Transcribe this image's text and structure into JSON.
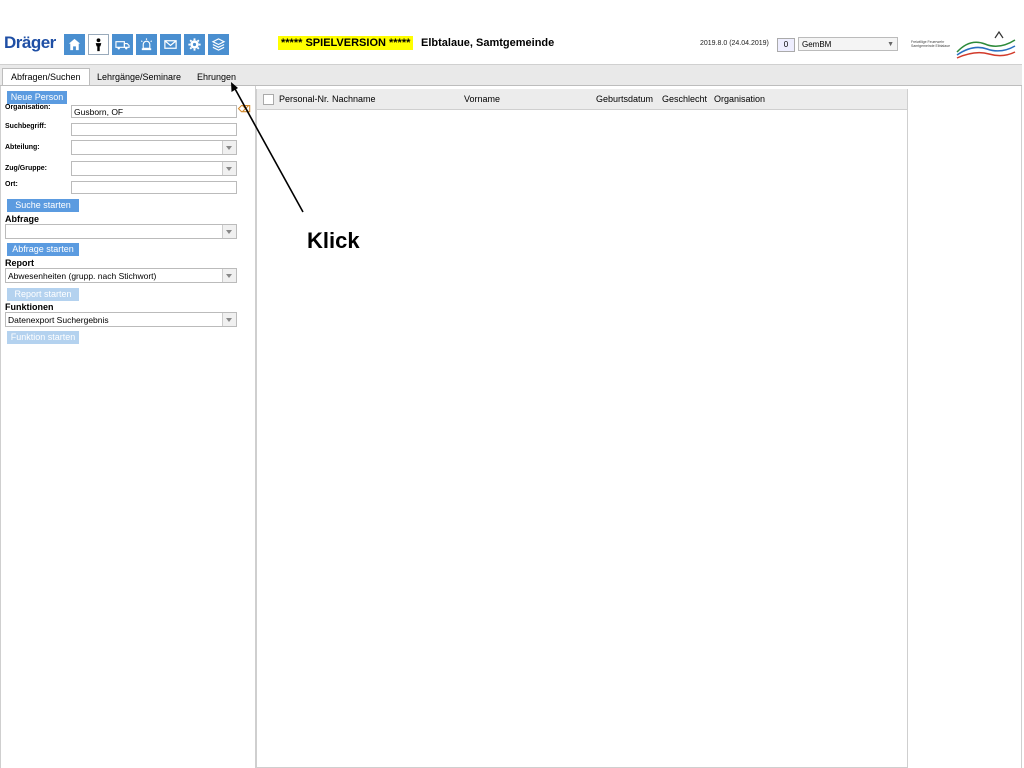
{
  "header": {
    "logo": "Dräger",
    "nav_icons": [
      "home-icon",
      "person-icon",
      "truck-icon",
      "alarm-icon",
      "mail-icon",
      "gear-icon",
      "layers-icon"
    ],
    "banner": "***** SPIELVERSION *****",
    "org_title": "Elbtalaue, Samtgemeinde",
    "version": "2019.8.0 (24.04.2019)",
    "counter": "0",
    "role": "GemBM",
    "brand_text": "Freiwillige Feuerwehr Samtgemeinde Elbtalaue"
  },
  "tabs": [
    "Abfragen/Suchen",
    "Lehrgänge/Seminare",
    "Ehrungen"
  ],
  "search": {
    "new_person": "Neue Person",
    "org_label": "Organisation:",
    "org_value": "Gusborn, OF",
    "term_label": "Suchbegriff:",
    "dept_label": "Abteilung:",
    "group_label": "Zug/Gruppe:",
    "place_label": "Ort:",
    "search_btn": "Suche starten",
    "query_section": "Abfrage",
    "query_btn": "Abfrage starten",
    "report_section": "Report",
    "report_value": "Abwesenheiten (grupp. nach Stichwort)",
    "report_btn": "Report starten",
    "func_section": "Funktionen",
    "func_value": "Datenexport Suchergebnis",
    "func_btn": "Funktion starten"
  },
  "grid": {
    "columns": [
      "Personal-Nr.",
      "Nachname",
      "Vorname",
      "Geburtsdatum",
      "Geschlecht",
      "Organisation"
    ]
  },
  "annotation": {
    "text": "Klick"
  },
  "colors": {
    "accent": "#5b9be0",
    "banner": "#ffff00",
    "logo": "#1f4fa5"
  }
}
